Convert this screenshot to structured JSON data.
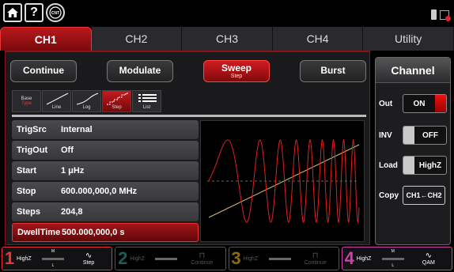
{
  "top": {
    "help_label": "?",
    "icons": [
      "home-icon",
      "help-icon",
      "cnt-icon",
      "usb-icon",
      "lan-icon"
    ]
  },
  "tabs": [
    {
      "label": "CH1",
      "active": true
    },
    {
      "label": "CH2",
      "active": false
    },
    {
      "label": "CH3",
      "active": false
    },
    {
      "label": "CH4",
      "active": false
    },
    {
      "label": "Utility",
      "active": false
    }
  ],
  "modes": {
    "continue": "Continue",
    "modulate": "Modulate",
    "sweep": "Sweep",
    "sweep_sub": "Step",
    "burst": "Burst"
  },
  "sweep_types": {
    "base_line1": "Base",
    "base_line2": "Type",
    "line": "Line",
    "log": "Log",
    "step": "Step",
    "list": "List",
    "selected": "Step"
  },
  "params": [
    {
      "key": "TrigSrc",
      "value": "Internal"
    },
    {
      "key": "TrigOut",
      "value": "Off"
    },
    {
      "key": "Start",
      "value": "1 μHz"
    },
    {
      "key": "Stop",
      "value": "600.000,000,0 MHz"
    },
    {
      "key": "Steps",
      "value": "204,8"
    },
    {
      "key": "DwellTime",
      "value": "500.000,000,0 s"
    }
  ],
  "channel_panel": {
    "title": "Channel",
    "out_label": "Out",
    "out_value": "ON",
    "inv_label": "INV",
    "inv_value": "OFF",
    "load_label": "Load",
    "load_value": "HighZ",
    "copy_label": "Copy",
    "copy_value": "CH1←CH2"
  },
  "bottom": [
    {
      "num": "1",
      "imp": "HighZ",
      "top": "M",
      "bottom": "L",
      "wave": "Step"
    },
    {
      "num": "2",
      "imp": "HighZ",
      "top": "",
      "bottom": "",
      "wave": "Continue"
    },
    {
      "num": "3",
      "imp": "HighZ",
      "top": "",
      "bottom": "",
      "wave": "Continue"
    },
    {
      "num": "4",
      "imp": "HighZ",
      "top": "M",
      "bottom": "L",
      "wave": "QAM"
    }
  ],
  "colors": {
    "accent": "#c8181c",
    "ch4": "#cc44aa"
  }
}
